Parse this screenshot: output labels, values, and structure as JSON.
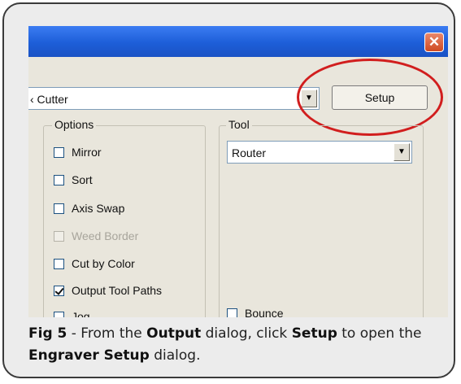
{
  "dialog": {
    "close_glyph": "✕",
    "mode_select": {
      "value": "‹ Cutter",
      "arrow": "▼"
    },
    "setup_button": "Setup",
    "options_group": {
      "title": "Options",
      "items": [
        {
          "label": "Mirror",
          "checked": false,
          "enabled": true
        },
        {
          "label": "Sort",
          "checked": false,
          "enabled": true
        },
        {
          "label": "Axis Swap",
          "checked": false,
          "enabled": true
        },
        {
          "label": "Weed Border",
          "checked": false,
          "enabled": false
        },
        {
          "label": "Cut by Color",
          "checked": false,
          "enabled": true
        },
        {
          "label": "Output Tool Paths",
          "checked": true,
          "enabled": true
        },
        {
          "label": "Jog",
          "checked": false,
          "enabled": true
        }
      ]
    },
    "tool_group": {
      "title": "Tool",
      "select_value": "Router",
      "arrow": "▼",
      "bounce_label": "Bounce"
    },
    "highlight_color": "#d11e1e"
  },
  "caption": {
    "fig": "Fig 5",
    "t1": " - From the ",
    "b1": "Output",
    "t2": " dialog, click ",
    "b2": "Setup",
    "t3": " to open the ",
    "b3": "Engraver Setup",
    "t4": " dialog."
  }
}
